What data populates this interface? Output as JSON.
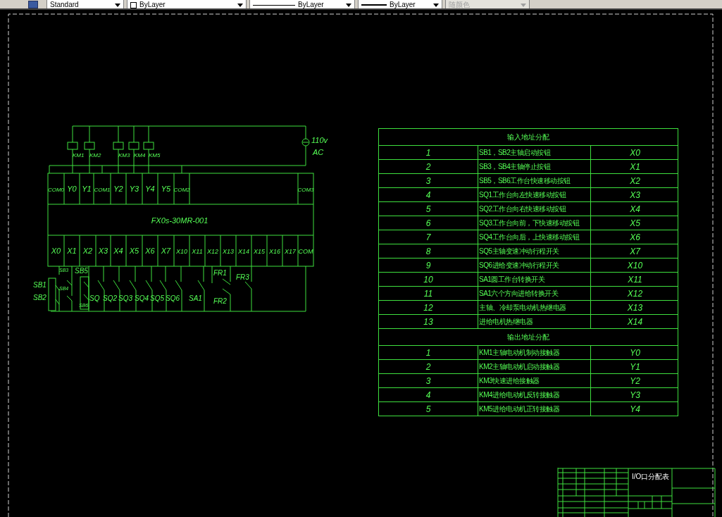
{
  "toolbar": {
    "items": [
      {
        "kind": "textstyle",
        "value": "Standard",
        "disabled": false
      },
      {
        "kind": "color",
        "value": "ByLayer",
        "disabled": false
      },
      {
        "kind": "linetype",
        "value": "ByLayer",
        "disabled": false
      },
      {
        "kind": "lineweight",
        "value": "ByLayer",
        "disabled": false
      },
      {
        "kind": "plotstyle",
        "value": "随颜色",
        "disabled": true
      }
    ]
  },
  "schematic": {
    "power_label": "110v",
    "power_type": "AC",
    "coils": [
      "KM1",
      "KM2",
      "KM3",
      "KM4",
      "KM5"
    ],
    "output_terminals": [
      "COM0",
      "Y0",
      "Y1",
      "COM1",
      "Y2",
      "Y3",
      "Y4",
      "Y5",
      "COM2"
    ],
    "output_right_terminal": "COM3",
    "plc_model": "FX0s-30MR-001",
    "input_terminals": [
      "X0",
      "X1",
      "X2",
      "X3",
      "X4",
      "X5",
      "X6",
      "X7",
      "X10",
      "X11",
      "X12",
      "X13",
      "X14",
      "X15",
      "X16",
      "X17",
      "COM"
    ],
    "devices": [
      "SB1",
      "SB2",
      "SB3",
      "SB4",
      "SB5",
      "SB6",
      "SQ",
      "SQ2",
      "SQ3",
      "SQ4",
      "SQ5",
      "SQ6",
      "SA1",
      "FR1",
      "FR2",
      "FR3"
    ]
  },
  "input_table": {
    "title": "输入地址分配",
    "rows": [
      {
        "no": "1",
        "description": "SB1，SB2主轴启动按钮",
        "address": "X0"
      },
      {
        "no": "2",
        "description": "SB3，SB4主轴停止按钮",
        "address": "X1"
      },
      {
        "no": "3",
        "description": "SB5，SB6工作台快速移动按钮",
        "address": "X2"
      },
      {
        "no": "4",
        "description": "SQ1工作台向左快速移动按钮",
        "address": "X3"
      },
      {
        "no": "5",
        "description": "SQ2工作台向右快速移动按钮",
        "address": "X4"
      },
      {
        "no": "6",
        "description": "SQ3工作台向前，下快速移动按钮",
        "address": "X5"
      },
      {
        "no": "7",
        "description": "SQ4工作台向后，上快速移动按钮",
        "address": "X6"
      },
      {
        "no": "8",
        "description": "SQ5主轴变速冲动行程开关",
        "address": "X7"
      },
      {
        "no": "9",
        "description": "SQ6进给变速冲动行程开关",
        "address": "X10"
      },
      {
        "no": "10",
        "description": "SA1圆工作台转换开关",
        "address": "X11"
      },
      {
        "no": "11",
        "description": "SA1六个方向进给转换开关",
        "address": "X12"
      },
      {
        "no": "12",
        "description": "主轴、冷却泵电动机热继电器",
        "address": "X13"
      },
      {
        "no": "13",
        "description": "进给电机热继电器",
        "address": "X14"
      }
    ]
  },
  "output_table": {
    "title": "输出地址分配",
    "rows": [
      {
        "no": "1",
        "description": "KM1主轴电动机制动接触器",
        "address": "Y0"
      },
      {
        "no": "2",
        "description": "KM2主轴电动机启动接触器",
        "address": "Y1"
      },
      {
        "no": "3",
        "description": "KM3快速进给接触器",
        "address": "Y2"
      },
      {
        "no": "4",
        "description": "KM4进给电动机反转接触器",
        "address": "Y3"
      },
      {
        "no": "5",
        "description": "KM5进给电动机正转接触器",
        "address": "Y4"
      }
    ]
  },
  "title_block": {
    "title": "I/O口分配表"
  }
}
